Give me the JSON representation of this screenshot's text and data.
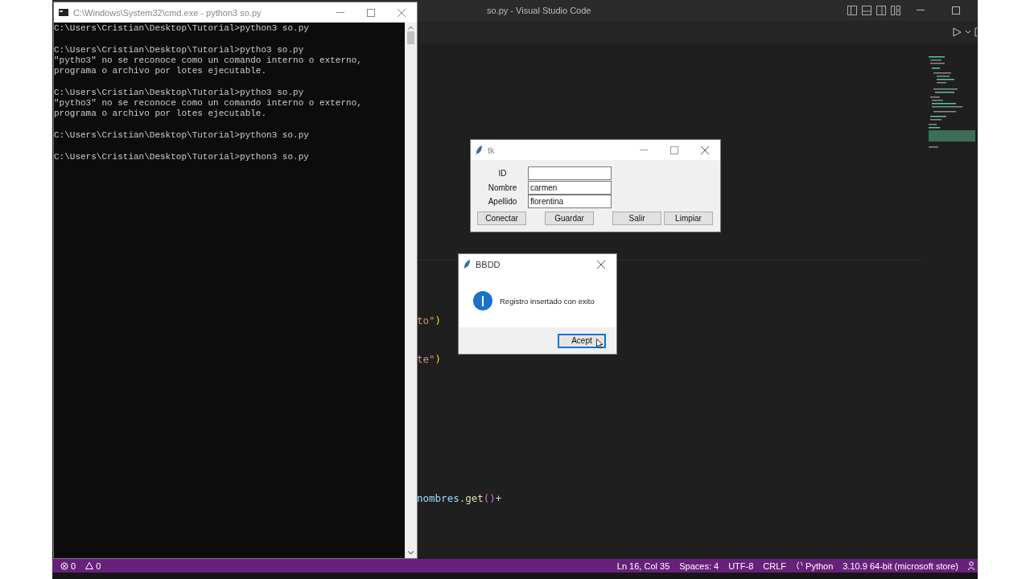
{
  "editor_window": {
    "title": "so.py - Visual Studio Code",
    "code_lines": [
      {
        "tokens": [
          {
            "text": "to\"",
            "kind": "string"
          },
          {
            "text": ")",
            "kind": "bracket"
          }
        ]
      },
      {
        "tokens": [
          {
            "text": "te\"",
            "kind": "string"
          },
          {
            "text": ")",
            "kind": "bracket"
          }
        ]
      },
      {
        "tokens": [
          {
            "text": "nombres",
            "kind": "variable"
          },
          {
            "text": ".",
            "kind": "plain"
          },
          {
            "text": "get",
            "kind": "function"
          },
          {
            "text": "()",
            "kind": "paren"
          },
          {
            "text": "+",
            "kind": "plain"
          }
        ]
      }
    ],
    "status_bar": {
      "left": [
        {
          "kind": "error",
          "text": "0"
        },
        {
          "kind": "warning",
          "text": "0"
        }
      ],
      "right": [
        {
          "kind": "text",
          "text": "Ln 16, Col 35"
        },
        {
          "kind": "text",
          "text": "Spaces: 4"
        },
        {
          "kind": "text",
          "text": "UTF-8"
        },
        {
          "kind": "text",
          "text": "CRLF"
        },
        {
          "kind": "language",
          "text": "Python"
        },
        {
          "kind": "text",
          "text": "3.10.9 64-bit (microsoft store)"
        },
        {
          "kind": "account"
        }
      ]
    }
  },
  "console_window": {
    "title": "C:\\Windows\\System32\\cmd.exe - python3  so.py",
    "blocks": [
      [
        "C:\\Users\\Cristian\\Desktop\\Tutorial>python3 so.py"
      ],
      [
        "C:\\Users\\Cristian\\Desktop\\Tutorial>pytho3 so.py",
        "\"pytho3\" no se reconoce como un comando interno o externo,",
        "programa o archivo por lotes ejecutable."
      ],
      [
        "C:\\Users\\Cristian\\Desktop\\Tutorial>pytho3 so.py",
        "\"pytho3\" no se reconoce como un comando interno o externo,",
        "programa o archivo por lotes ejecutable."
      ],
      [
        "C:\\Users\\Cristian\\Desktop\\Tutorial>python3 so.py"
      ],
      [
        "C:\\Users\\Cristian\\Desktop\\Tutorial>python3 so.py"
      ]
    ]
  },
  "form_window": {
    "title": "tk",
    "fields": [
      {
        "label": "ID"
      },
      {
        "label": "Nombre",
        "value": "carmen"
      },
      {
        "label": "Apellido",
        "value": "florentina"
      }
    ],
    "buttons": [
      "Conectar",
      "Guardar",
      "Salir",
      "Limpiar"
    ]
  },
  "message_dialog": {
    "title": "BBDD",
    "message": "Registro insertado con exito",
    "button": "Acept"
  }
}
